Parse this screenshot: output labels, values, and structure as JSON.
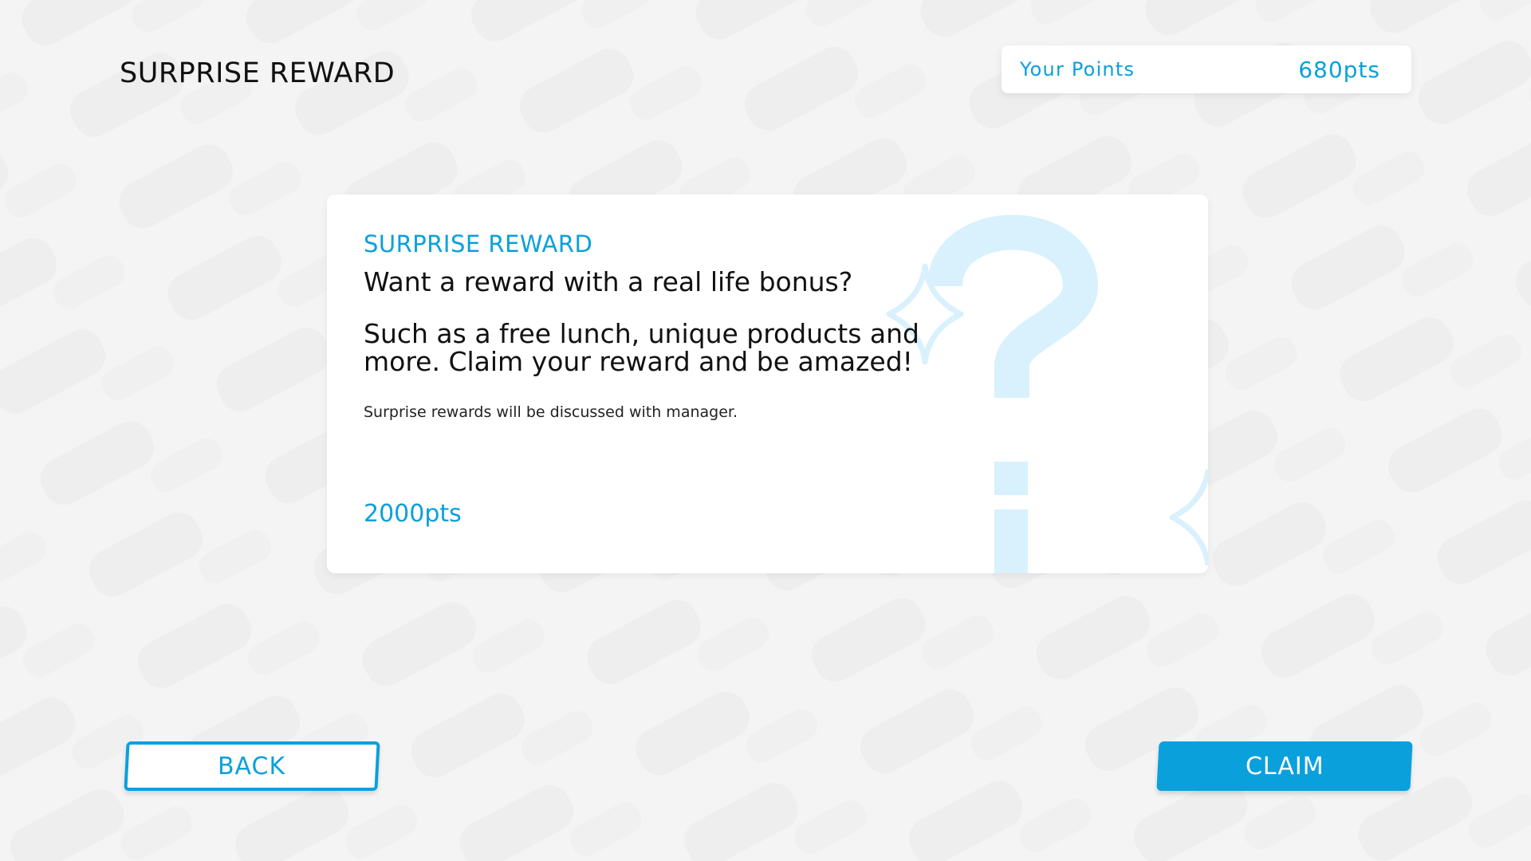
{
  "header": {
    "title": "SURPRISE REWARD",
    "points_label": "Your Points",
    "points_value": "680pts"
  },
  "reward_card": {
    "eyebrow": "SURPRISE REWARD",
    "headline": "Want a reward with a real life bonus?",
    "body": "Such as a free lunch, unique products and more. Claim your reward and be amazed!",
    "note": "Surprise rewards will be discussed with manager.",
    "cost": "2000pts",
    "icons": [
      "question-mark-icon",
      "sparkle-icon"
    ]
  },
  "actions": {
    "back_label": "BACK",
    "claim_label": "CLAIM"
  },
  "colors": {
    "accent": "#0aa0dc",
    "background": "#f4f4f4",
    "card": "#ffffff",
    "decoration": "#d9f1fc"
  }
}
